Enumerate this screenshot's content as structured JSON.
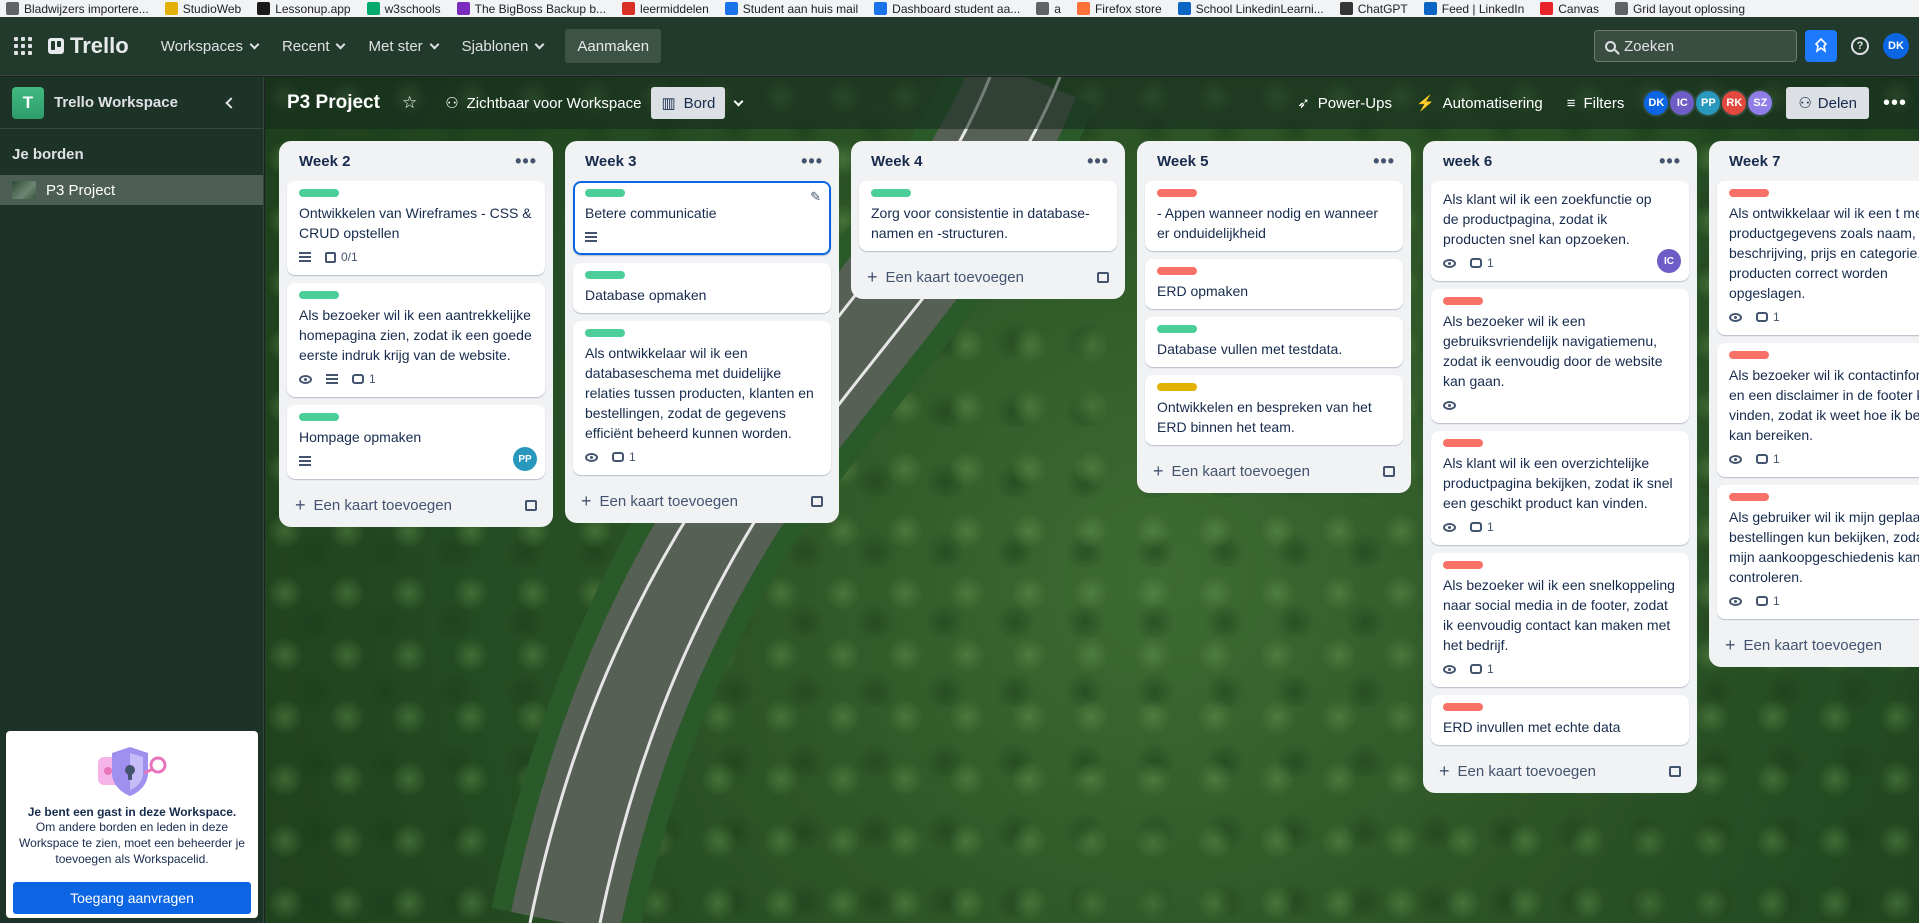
{
  "bookmarks": [
    {
      "label": "Bladwijzers importere...",
      "icon": "import-icon",
      "color": "#5f6368"
    },
    {
      "label": "StudioWeb",
      "icon": "studioweb-icon",
      "color": "#e2b007"
    },
    {
      "label": "Lessonup.app",
      "icon": "lessonup-icon",
      "color": "#1a1a1a"
    },
    {
      "label": "w3schools",
      "icon": "w3schools-icon",
      "color": "#04aa6d"
    },
    {
      "label": "The BigBoss Backup b...",
      "icon": "bigboss-icon",
      "color": "#7b2cbf"
    },
    {
      "label": "leermiddelen",
      "icon": "leermiddelen-icon",
      "color": "#d93025"
    },
    {
      "label": "Student aan huis mail",
      "icon": "mail-icon",
      "color": "#1a73e8"
    },
    {
      "label": "Dashboard student aa...",
      "icon": "dashboard-icon",
      "color": "#1a73e8"
    },
    {
      "label": "a",
      "icon": "globe-icon",
      "color": "#5f6368"
    },
    {
      "label": "Firefox store",
      "icon": "firefox-icon",
      "color": "#ff7139"
    },
    {
      "label": "School LinkedinLearni...",
      "icon": "linkedin-icon",
      "color": "#0a66c2"
    },
    {
      "label": "ChatGPT",
      "icon": "chatgpt-icon",
      "color": "#333333"
    },
    {
      "label": "Feed | LinkedIn",
      "icon": "linkedin-icon",
      "color": "#0a66c2"
    },
    {
      "label": "Canvas",
      "icon": "canvas-icon",
      "color": "#e72429"
    },
    {
      "label": "Grid layout oplossing",
      "icon": "globe-icon",
      "color": "#5f6368"
    }
  ],
  "nav": {
    "logo": "Trello",
    "menus": [
      "Workspaces",
      "Recent",
      "Met ster",
      "Sjablonen"
    ],
    "create": "Aanmaken",
    "search_placeholder": "Zoeken",
    "help": "?",
    "user_initials": "DK"
  },
  "sidebar": {
    "workspace_initial": "T",
    "workspace_name": "Trello Workspace",
    "boards_title": "Je borden",
    "boards": [
      "P3 Project"
    ],
    "guest": {
      "title": "Je bent een gast in deze Workspace.",
      "text": "Om andere borden en leden in deze Workspace te zien, moet een beheerder je toevoegen als Workspacelid.",
      "button": "Toegang aanvragen"
    }
  },
  "board": {
    "title": "P3 Project",
    "visibility": "Zichtbaar voor Workspace",
    "view": "Bord",
    "powerups": "Power-Ups",
    "automation": "Automatisering",
    "filters": "Filters",
    "share": "Delen",
    "members": [
      {
        "initials": "DK",
        "color": "#0c66e4"
      },
      {
        "initials": "IC",
        "color": "#6e5dc6"
      },
      {
        "initials": "PP",
        "color": "#2898bd"
      },
      {
        "initials": "RK",
        "color": "#e2483d"
      },
      {
        "initials": "SZ",
        "color": "#8f7ee7"
      }
    ],
    "add_card": "Een kaart toevoegen"
  },
  "colors": {
    "green_label": "#4bce97",
    "red_label": "#f87168",
    "yellow_label": "#e2b203"
  },
  "lists": [
    {
      "title": "Week 2",
      "cards": [
        {
          "label": "green",
          "title": "Ontwikkelen van Wireframes - CSS & CRUD opstellen",
          "desc": true,
          "checklist": "0/1"
        },
        {
          "label": "green",
          "title": "Als bezoeker wil ik een aantrekkelijke homepagina zien, zodat ik een goede eerste indruk krijg van de website.",
          "watch": true,
          "desc": true,
          "comments": "1"
        },
        {
          "label": "green",
          "title": "Hompage opmaken",
          "desc": true,
          "member": "PP"
        }
      ]
    },
    {
      "title": "Week 3",
      "cards": [
        {
          "label": "green",
          "title": "Betere communicatie",
          "desc": true,
          "focus": true
        },
        {
          "label": "green",
          "title": "Database opmaken"
        },
        {
          "label": "green",
          "title": "Als ontwikkelaar wil ik een databaseschema met duidelijke relaties tussen producten, klanten en bestellingen, zodat de gegevens efficiënt beheerd kunnen worden.",
          "watch": true,
          "comments": "1"
        }
      ]
    },
    {
      "title": "Week 4",
      "cards": [
        {
          "label": "green",
          "title": "Zorg voor consistentie in database-namen en -structuren."
        }
      ]
    },
    {
      "title": "Week 5",
      "cards": [
        {
          "label": "red",
          "title": "- Appen wanneer nodig en wanneer er onduidelijkheid"
        },
        {
          "label": "red",
          "title": "ERD opmaken"
        },
        {
          "label": "green",
          "title": "Database vullen met testdata."
        },
        {
          "label": "yellow",
          "title": "Ontwikkelen en bespreken van het ERD binnen het team."
        }
      ]
    },
    {
      "title": "week 6",
      "cards": [
        {
          "label": "",
          "title": "Als klant wil ik een zoekfunctie op de productpagina, zodat ik producten snel kan opzoeken.",
          "watch": true,
          "comments": "1",
          "member": "IC"
        },
        {
          "label": "red",
          "title": "Als bezoeker wil ik een gebruiksvriendelijk navigatiemenu, zodat ik eenvoudig door de website kan gaan.",
          "watch": true
        },
        {
          "label": "red",
          "title": "Als klant wil ik een overzichtelijke productpagina bekijken, zodat ik snel een geschikt product kan vinden.",
          "watch": true,
          "comments": "1"
        },
        {
          "label": "red",
          "title": "Als bezoeker wil ik een snelkoppeling naar social media in de footer, zodat ik eenvoudig contact kan maken met het bedrijf.",
          "watch": true,
          "comments": "1"
        },
        {
          "label": "red",
          "title": "ERD invullen met echte data"
        }
      ]
    },
    {
      "title": "Week 7",
      "cards": [
        {
          "label": "red",
          "title": "Als ontwikkelaar wil ik een t met productgegevens zoals naam, beschrijving, prijs en categorie, zodat producten correct worden opgeslagen.",
          "watch": true,
          "comments": "1"
        },
        {
          "label": "red",
          "title": "Als bezoeker wil ik contactinformatie en een disclaimer in de footer kunn vinden, zodat ik weet hoe ik bedrijf kan bereiken.",
          "watch": true,
          "comments": "1"
        },
        {
          "label": "red",
          "title": "Als gebruiker wil ik mijn geplaatste bestellingen kun bekijken, zodat ik mijn aankoopgeschiedenis kan controleren.",
          "watch": true,
          "comments": "1"
        }
      ]
    }
  ]
}
